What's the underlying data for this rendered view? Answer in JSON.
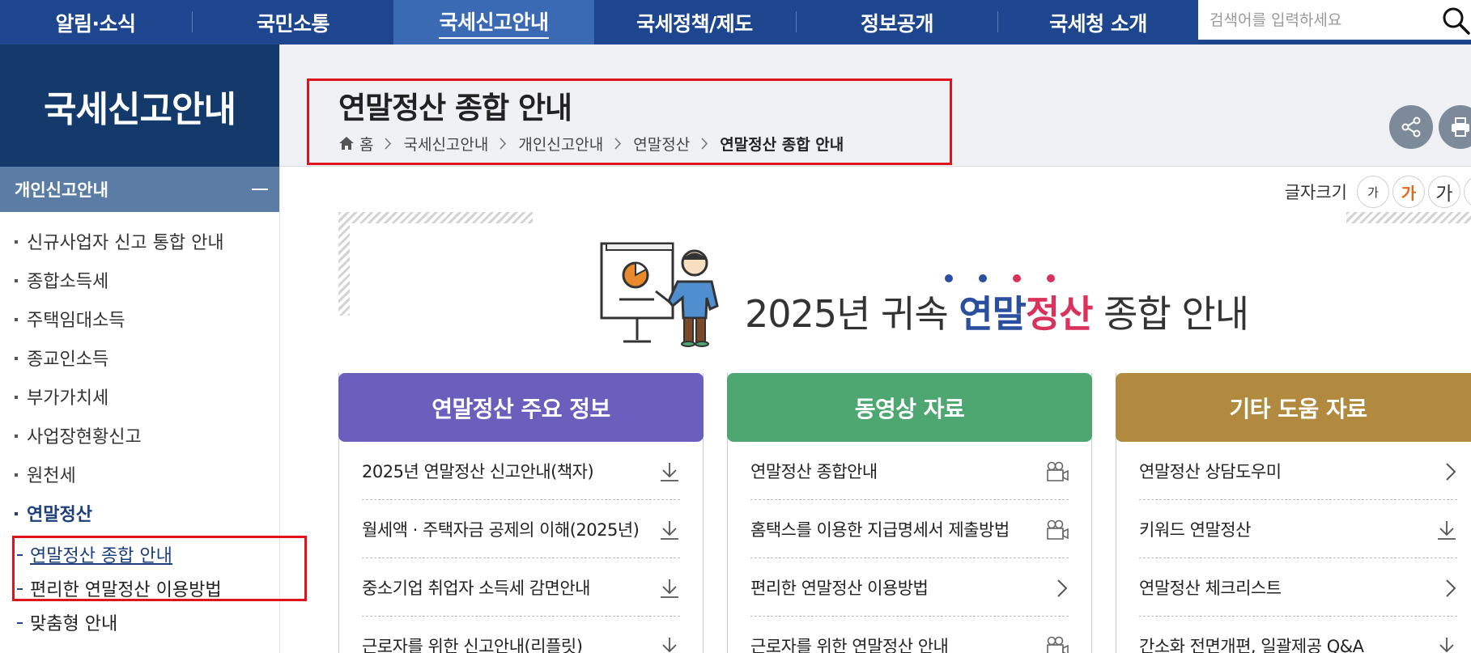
{
  "topnav": {
    "items": [
      {
        "label": "알림·소식"
      },
      {
        "label": "국민소통"
      },
      {
        "label": "국세신고안내"
      },
      {
        "label": "국세정책/제도"
      },
      {
        "label": "정보공개"
      },
      {
        "label": "국세청 소개"
      }
    ],
    "search_placeholder": "검색어를 입력하세요"
  },
  "sidebar": {
    "title": "국세신고안내",
    "group": "개인신고안내",
    "items": [
      {
        "label": "신규사업자 신고 통합 안내"
      },
      {
        "label": "종합소득세"
      },
      {
        "label": "주택임대소득"
      },
      {
        "label": "종교인소득"
      },
      {
        "label": "부가가치세"
      },
      {
        "label": "사업장현황신고"
      },
      {
        "label": "원천세"
      },
      {
        "label": "연말정산"
      }
    ],
    "subitems": [
      {
        "label": "연말정산 종합 안내"
      },
      {
        "label": "편리한 연말정산 이용방법"
      },
      {
        "label": "맞춤형 안내"
      }
    ]
  },
  "header": {
    "title": "연말정산 종합 안내",
    "breadcrumb": [
      "홈",
      "국세신고안내",
      "개인신고안내",
      "연말정산",
      "연말정산 종합 안내"
    ]
  },
  "fontsize": {
    "label": "글자크기",
    "options": [
      "가",
      "가",
      "가",
      "가"
    ]
  },
  "banner": {
    "prefix": "2025년 귀속 ",
    "blue": "연말",
    "pink": "정산",
    "suffix": " 종합 안내",
    "dot_colors": [
      "#2a4f9e",
      "#2a4f9e",
      "#d9325d",
      "#d9325d"
    ]
  },
  "cards": [
    {
      "title": "연말정산 주요 정보",
      "color": "#6a5fbd",
      "items": [
        {
          "label": "2025년 연말정산 신고안내(책자)",
          "icon": "download-icon"
        },
        {
          "label": "월세액 · 주택자금 공제의 이해(2025년)",
          "icon": "download-icon"
        },
        {
          "label": "중소기업 취업자 소득세 감면안내",
          "icon": "download-icon"
        },
        {
          "label": "근로자를 위한 신고안내(리플릿)",
          "icon": "download-icon"
        }
      ]
    },
    {
      "title": "동영상 자료",
      "color": "#4ea771",
      "items": [
        {
          "label": "연말정산 종합안내",
          "icon": "video-camera-icon"
        },
        {
          "label": "홈택스를 이용한 지급명세서 제출방법",
          "icon": "video-camera-icon"
        },
        {
          "label": "편리한 연말정산 이용방법",
          "icon": "chevron-right-icon"
        },
        {
          "label": "근로자를 위한 연말정산 안내",
          "icon": "video-camera-icon"
        }
      ]
    },
    {
      "title": "기타 도움 자료",
      "color": "#b18a3f",
      "items": [
        {
          "label": "연말정산 상담도우미",
          "icon": "chevron-right-icon"
        },
        {
          "label": "키워드 연말정산",
          "icon": "download-icon"
        },
        {
          "label": "연말정산 체크리스트",
          "icon": "chevron-right-icon"
        },
        {
          "label": "간소화 전면개편, 일괄제공 Q&A",
          "icon": "download-icon"
        }
      ]
    }
  ]
}
